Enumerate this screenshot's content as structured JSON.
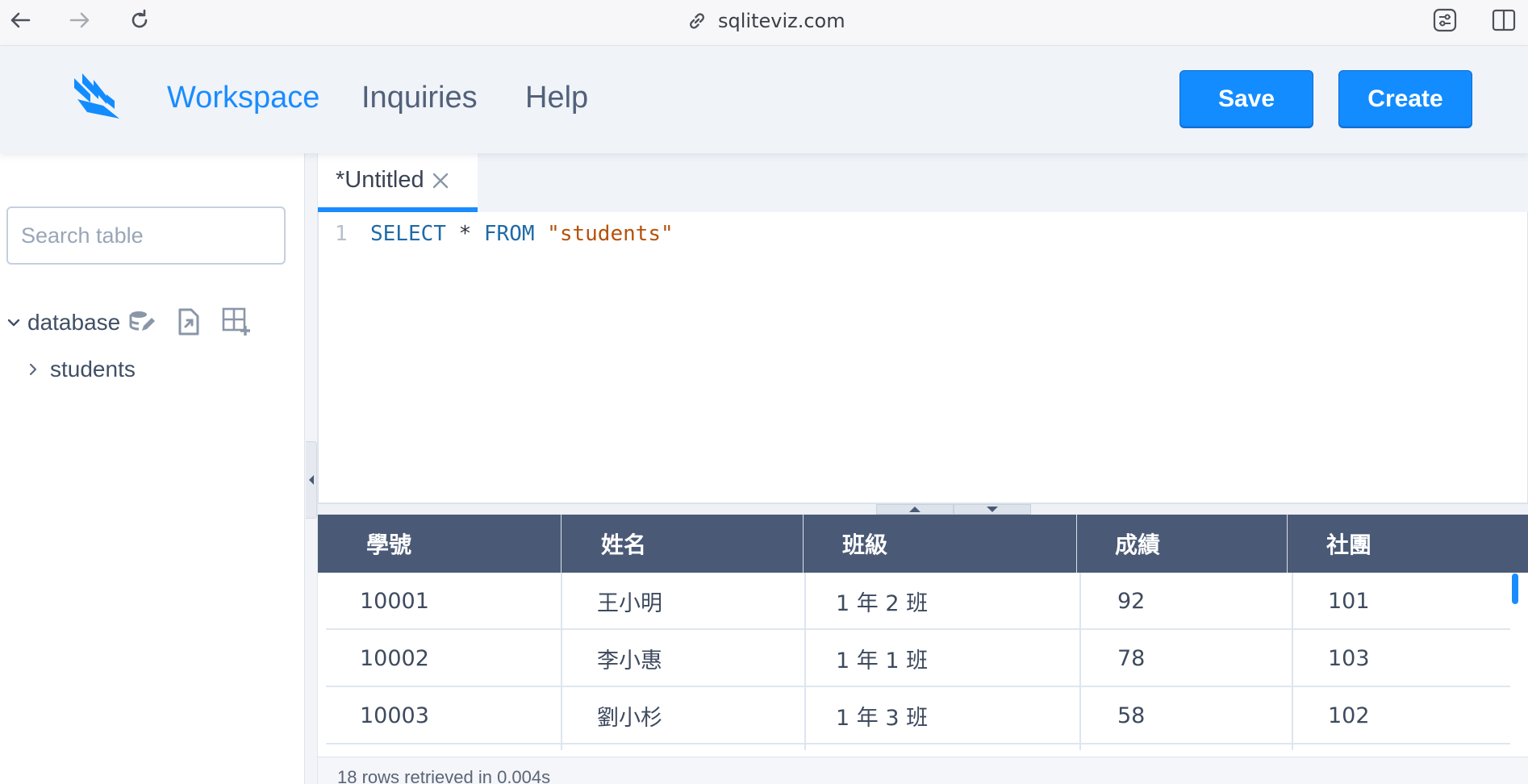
{
  "browser": {
    "url": "sqliteviz.com",
    "back_icon": "arrow-left-icon",
    "forward_icon": "arrow-right-icon",
    "reload_icon": "reload-icon"
  },
  "header": {
    "nav": [
      "Workspace",
      "Inquiries",
      "Help"
    ],
    "active_nav": "Workspace",
    "save_label": "Save",
    "create_label": "Create",
    "accent_color": "#1a8cff"
  },
  "sidebar": {
    "search_placeholder": "Search table",
    "database_label": "database",
    "tables": [
      "students"
    ]
  },
  "editor": {
    "tab_title": "*Untitled",
    "line_number": "1",
    "query": {
      "kw1": "SELECT",
      "op": "*",
      "kw2": "FROM",
      "str": "\"students\""
    }
  },
  "results": {
    "columns": [
      "學號",
      "姓名",
      "班級",
      "成績",
      "社團"
    ],
    "rows": [
      [
        "10001",
        "王小明",
        "1 年 2 班",
        "92",
        "101"
      ],
      [
        "10002",
        "李小惠",
        "1 年 1 班",
        "78",
        "103"
      ],
      [
        "10003",
        "劉小杉",
        "1 年 3 班",
        "58",
        "102"
      ]
    ],
    "status": "18 rows retrieved in 0.004s",
    "header_color": "#4a5a76"
  }
}
